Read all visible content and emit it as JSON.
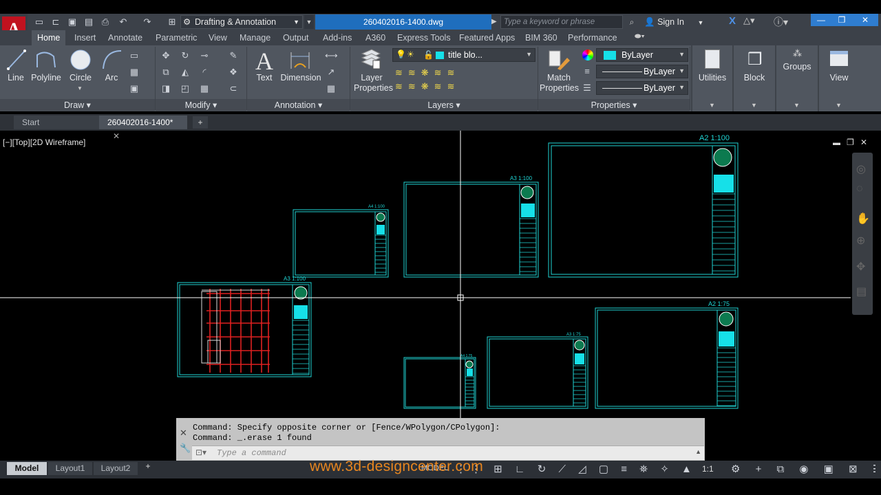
{
  "app": {
    "logo_letter": "A"
  },
  "quick_access": {
    "icons": [
      "new-icon",
      "open-icon",
      "save-icon",
      "saveas-icon",
      "print-icon",
      "undo-icon",
      "redo-icon",
      "share-icon"
    ]
  },
  "workspace": {
    "label": "Drafting & Annotation"
  },
  "file_tab": {
    "label": "260402016-1400.dwg"
  },
  "search": {
    "placeholder": "Type a keyword or phrase"
  },
  "signin": {
    "label": "Sign In"
  },
  "ribbon_tabs": [
    "Home",
    "Insert",
    "Annotate",
    "Parametric",
    "View",
    "Manage",
    "Output",
    "Add-ins",
    "A360",
    "Express Tools",
    "Featured Apps",
    "BIM 360",
    "Performance"
  ],
  "draw_panel": {
    "title": "Draw",
    "tools": [
      "Line",
      "Polyline",
      "Circle",
      "Arc"
    ]
  },
  "modify_panel": {
    "title": "Modify"
  },
  "annotation_panel": {
    "title": "Annotation",
    "tools": [
      "Text",
      "Dimension"
    ]
  },
  "layers_panel": {
    "title": "Layers",
    "layer_props": "Layer\nProperties",
    "current_layer": "title blo..."
  },
  "properties_panel": {
    "title": "Properties",
    "match": "Match\nProperties",
    "color": "ByLayer",
    "linetype": "ByLayer",
    "lineweight": "ByLayer"
  },
  "utilities": {
    "label": "Utilities"
  },
  "block": {
    "label": "Block"
  },
  "groups": {
    "label": "Groups"
  },
  "view": {
    "label": "View"
  },
  "doc_tabs": {
    "start": "Start",
    "active": "260402016-1400*"
  },
  "viewport_controls": "[−][Top][2D Wireframe]",
  "sheets": [
    {
      "scale": "A4 1:100"
    },
    {
      "scale": "A3 1:100"
    },
    {
      "scale": "A2 1:100"
    },
    {
      "scale": "A3 1:100"
    },
    {
      "scale": "A4 1:75"
    },
    {
      "scale": "A3 1:75"
    },
    {
      "scale": "A2 1:75"
    }
  ],
  "command": {
    "history_1": "Command: Specify opposite corner or [Fence/WPolygon/CPolygon]:",
    "history_2": "Command: _.erase 1 found",
    "placeholder": "Type a command"
  },
  "layout_tabs": [
    "Model",
    "Layout1",
    "Layout2"
  ],
  "status": {
    "model": "MODEL",
    "scale": "1:1"
  },
  "watermark": "www.3d-designcenter.com",
  "colors": {
    "accent": "#1f6ebd",
    "cad_cyan": "#1fd4d4",
    "autocad_red": "#c1121f"
  }
}
